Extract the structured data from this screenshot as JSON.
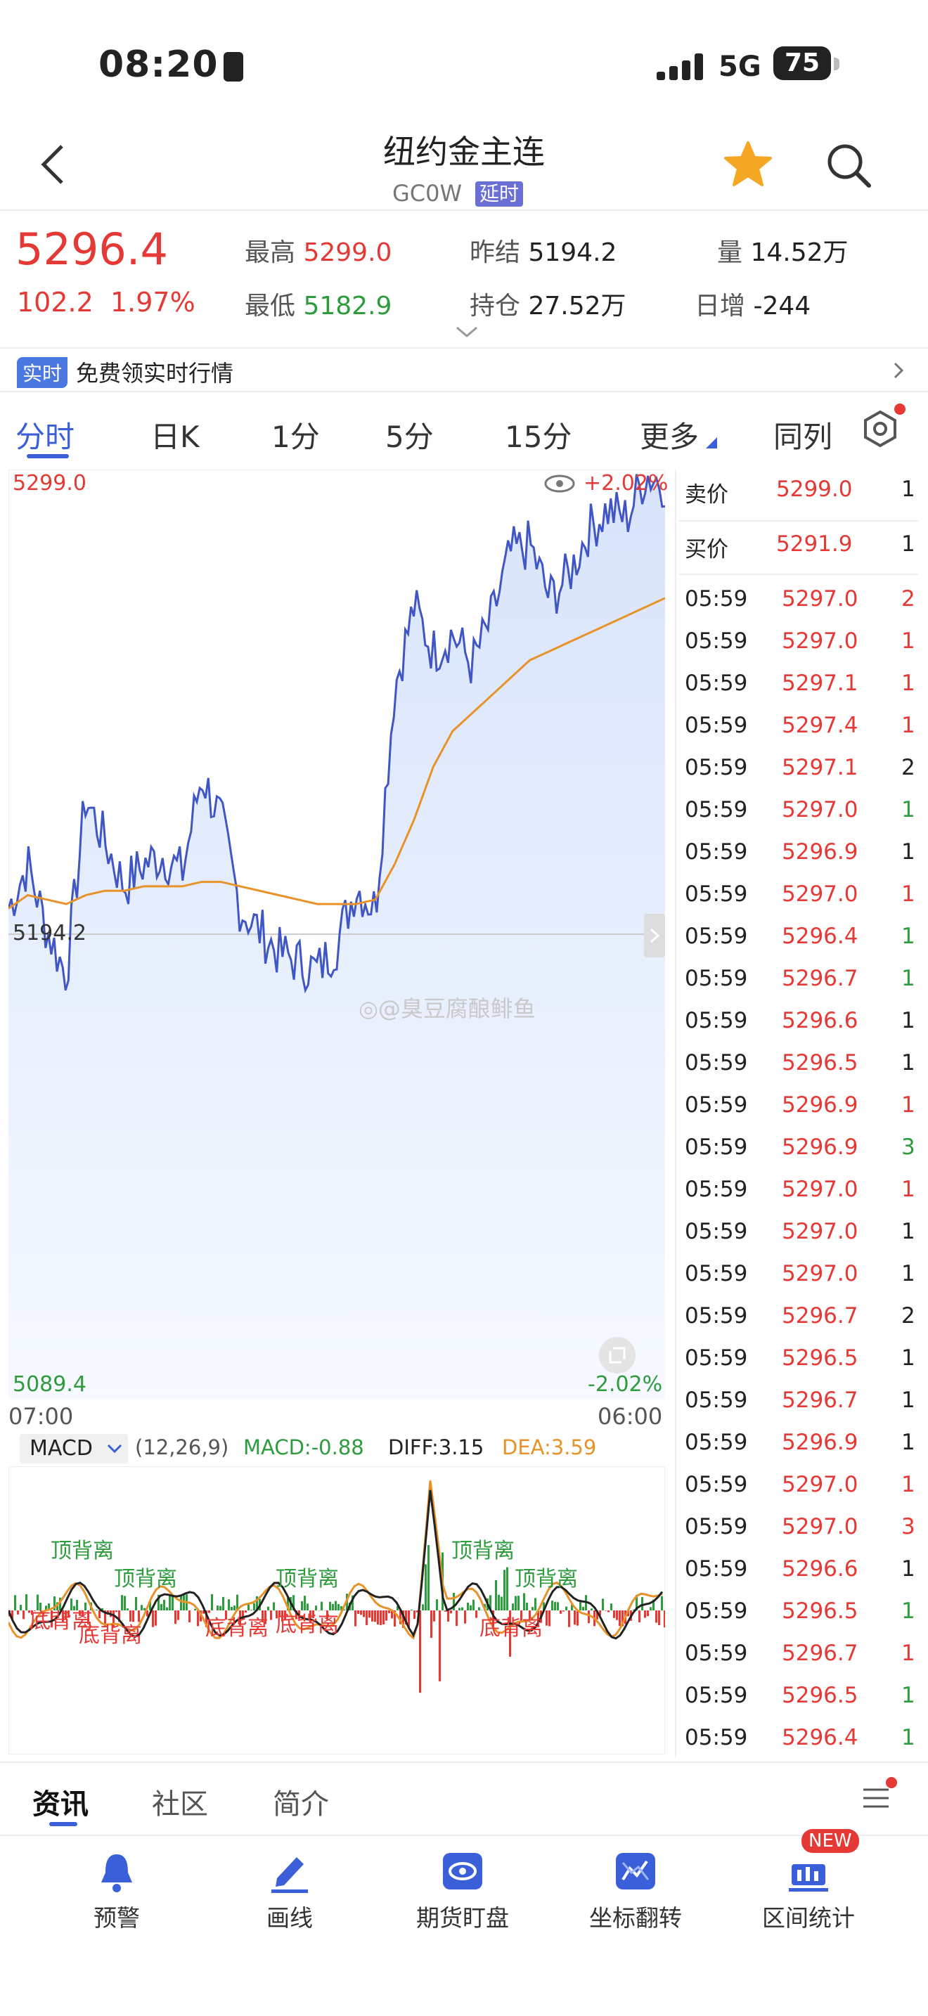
{
  "status": {
    "time": "08:20",
    "network": "5G",
    "battery": "75"
  },
  "header": {
    "title": "纽约金主连",
    "code": "GC0W",
    "badge": "延时"
  },
  "quote": {
    "price": "5296.4",
    "change": "102.2",
    "change_pct": "1.97%",
    "high_label": "最高",
    "high": "5299.0",
    "low_label": "最低",
    "low": "5182.9",
    "prev_label": "昨结",
    "prev": "5194.2",
    "oi_label": "持仓",
    "oi": "27.52万",
    "vol_label": "量",
    "vol": "14.52万",
    "day_inc_label": "日增",
    "day_inc": "-244"
  },
  "banner": {
    "badge": "实时",
    "text": "免费领实时行情"
  },
  "tabs": [
    "分时",
    "日K",
    "1分",
    "5分",
    "15分",
    "更多",
    "同列"
  ],
  "chart": {
    "top_price": "5299.0",
    "top_pct": "+2.02%",
    "bottom_price": "5089.4",
    "bottom_pct": "-2.02%",
    "mid_price": "5194.2",
    "time_start": "07:00",
    "time_end": "06:00",
    "watermark": "@臭豆腐酿鲱鱼"
  },
  "macd": {
    "name": "MACD",
    "params": "(12,26,9)",
    "macd": "MACD:-0.88",
    "diff": "DIFF:3.15",
    "dea": "DEA:3.59",
    "labels": [
      "顶背离",
      "顶背离",
      "顶背离",
      "顶背离",
      "顶背离",
      "底背离",
      "底背离",
      "底背离",
      "底背离",
      "底背离"
    ]
  },
  "chart_data": {
    "type": "line",
    "title": "",
    "series": [
      {
        "name": "",
        "values": [
          5200,
          5210,
          5195,
          5185,
          5225,
          5215,
          5205,
          5210,
          5212,
          5208,
          5230,
          5220,
          5200,
          5195,
          5190,
          5188,
          5186,
          5192,
          5205,
          5200,
          5250,
          5268,
          5258,
          5262,
          5255,
          5265,
          5280,
          5282,
          5270,
          5275,
          5285,
          5290,
          5288,
          5298,
          5296
        ]
      },
      {
        "name": "",
        "values": [
          5200,
          5203,
          5202,
          5201,
          5203,
          5204,
          5204,
          5205,
          5205,
          5205,
          5206,
          5206,
          5205,
          5204,
          5203,
          5202,
          5201,
          5201,
          5201,
          5202,
          5210,
          5220,
          5232,
          5240,
          5244,
          5248,
          5252,
          5256,
          5258,
          5260,
          5262,
          5264,
          5266,
          5268,
          5270
        ]
      }
    ],
    "ylim": [
      5089.4,
      5299.0
    ],
    "yticks": [
      "5299.0",
      "5194.2",
      "5089.4"
    ]
  },
  "order_book": {
    "ask_label": "卖价",
    "ask": "5299.0",
    "ask_qty": "1",
    "bid_label": "买价",
    "bid": "5291.9",
    "bid_qty": "1",
    "ticks": [
      {
        "t": "05:59",
        "p": "5297.0",
        "q": "2",
        "c": "red"
      },
      {
        "t": "05:59",
        "p": "5297.0",
        "q": "1",
        "c": "red"
      },
      {
        "t": "05:59",
        "p": "5297.1",
        "q": "1",
        "c": "red"
      },
      {
        "t": "05:59",
        "p": "5297.4",
        "q": "1",
        "c": "red"
      },
      {
        "t": "05:59",
        "p": "5297.1",
        "q": "2",
        "c": "dark"
      },
      {
        "t": "05:59",
        "p": "5297.0",
        "q": "1",
        "c": "green"
      },
      {
        "t": "05:59",
        "p": "5296.9",
        "q": "1",
        "c": "dark"
      },
      {
        "t": "05:59",
        "p": "5297.0",
        "q": "1",
        "c": "red"
      },
      {
        "t": "05:59",
        "p": "5296.4",
        "q": "1",
        "c": "green"
      },
      {
        "t": "05:59",
        "p": "5296.7",
        "q": "1",
        "c": "green"
      },
      {
        "t": "05:59",
        "p": "5296.6",
        "q": "1",
        "c": "dark"
      },
      {
        "t": "05:59",
        "p": "5296.5",
        "q": "1",
        "c": "dark"
      },
      {
        "t": "05:59",
        "p": "5296.9",
        "q": "1",
        "c": "red"
      },
      {
        "t": "05:59",
        "p": "5296.9",
        "q": "3",
        "c": "green"
      },
      {
        "t": "05:59",
        "p": "5297.0",
        "q": "1",
        "c": "red"
      },
      {
        "t": "05:59",
        "p": "5297.0",
        "q": "1",
        "c": "dark"
      },
      {
        "t": "05:59",
        "p": "5297.0",
        "q": "1",
        "c": "dark"
      },
      {
        "t": "05:59",
        "p": "5296.7",
        "q": "2",
        "c": "dark"
      },
      {
        "t": "05:59",
        "p": "5296.5",
        "q": "1",
        "c": "dark"
      },
      {
        "t": "05:59",
        "p": "5296.7",
        "q": "1",
        "c": "dark"
      },
      {
        "t": "05:59",
        "p": "5296.9",
        "q": "1",
        "c": "dark"
      },
      {
        "t": "05:59",
        "p": "5297.0",
        "q": "1",
        "c": "red"
      },
      {
        "t": "05:59",
        "p": "5297.0",
        "q": "3",
        "c": "red"
      },
      {
        "t": "05:59",
        "p": "5296.6",
        "q": "1",
        "c": "dark"
      },
      {
        "t": "05:59",
        "p": "5296.5",
        "q": "1",
        "c": "green"
      },
      {
        "t": "05:59",
        "p": "5296.7",
        "q": "1",
        "c": "red"
      },
      {
        "t": "05:59",
        "p": "5296.5",
        "q": "1",
        "c": "green"
      },
      {
        "t": "05:59",
        "p": "5296.4",
        "q": "1",
        "c": "green"
      }
    ]
  },
  "bottom_tabs": [
    "资讯",
    "社区",
    "简介"
  ],
  "nav": [
    {
      "label": "预警",
      "icon": "bell-icon"
    },
    {
      "label": "画线",
      "icon": "pen-icon"
    },
    {
      "label": "期货盯盘",
      "icon": "eye-icon"
    },
    {
      "label": "坐标翻转",
      "icon": "flip-icon"
    },
    {
      "label": "区间统计",
      "icon": "stats-icon",
      "badge": "NEW"
    }
  ],
  "colors": {
    "accent": "#3a5fd8",
    "up": "#e53935",
    "down": "#2e9b3e",
    "avg": "#e8922a"
  }
}
